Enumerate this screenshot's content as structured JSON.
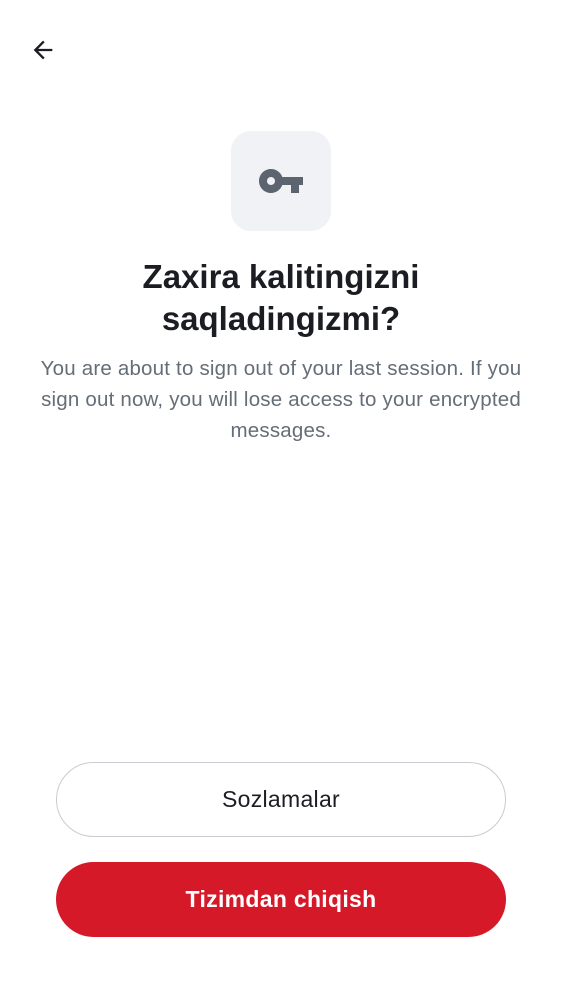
{
  "header": {
    "back_icon": "arrow-left-icon"
  },
  "hero": {
    "icon": "key-icon",
    "title": "Zaxira kalitingizni saqladingizmi?",
    "description": "You are about to sign out of your last session. If you sign out now, you will lose access to your encrypted messages."
  },
  "actions": {
    "settings_label": "Sozlamalar",
    "signout_label": "Tizimdan chiqish"
  },
  "colors": {
    "accent_danger": "#d51928",
    "icon_tile_bg": "#f0f2f5",
    "text_primary": "#1b1d22",
    "text_secondary": "#656d77",
    "outline": "#c8ccd2"
  }
}
